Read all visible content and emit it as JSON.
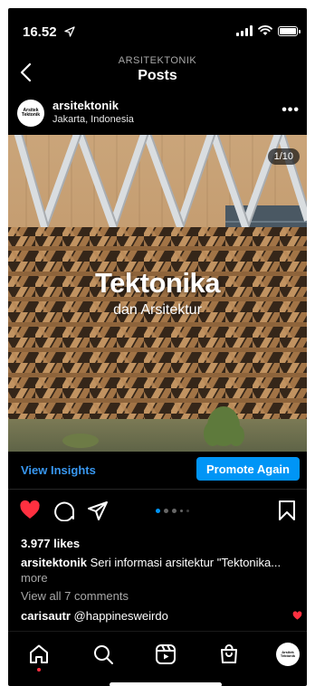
{
  "status_bar": {
    "time": "16.52"
  },
  "nav": {
    "account_label": "ARSITEKTONIK",
    "title": "Posts"
  },
  "post": {
    "username": "arsitektonik",
    "location": "Jakarta, Indonesia",
    "avatar_text": "Arsitek Tektonik",
    "image_counter": "1/10",
    "image_title": "Tektonika",
    "image_subtitle": "dan Arsitektur",
    "view_insights_label": "View Insights",
    "promote_label": "Promote Again",
    "carousel": {
      "total_dots": 5,
      "active_index": 0
    },
    "likes": "3.977 likes",
    "caption": {
      "username": "arsitektonik",
      "text": " Seri informasi arsitektur \"Tektonika...",
      "more": " more"
    },
    "view_comments": "View all 7 comments",
    "comment": {
      "username": "carisautr",
      "text": " @happinesweirdo"
    }
  },
  "colors": {
    "accent_blue": "#0095f6",
    "link_blue": "#3897f0",
    "like_red": "#ff3040",
    "wood": "#c49a6c"
  },
  "icons": {
    "actions": [
      "heart-icon",
      "comment-icon",
      "share-icon",
      "bookmark-icon"
    ],
    "tabs": [
      "home-icon",
      "search-icon",
      "reels-icon",
      "shop-icon",
      "profile-avatar"
    ]
  }
}
